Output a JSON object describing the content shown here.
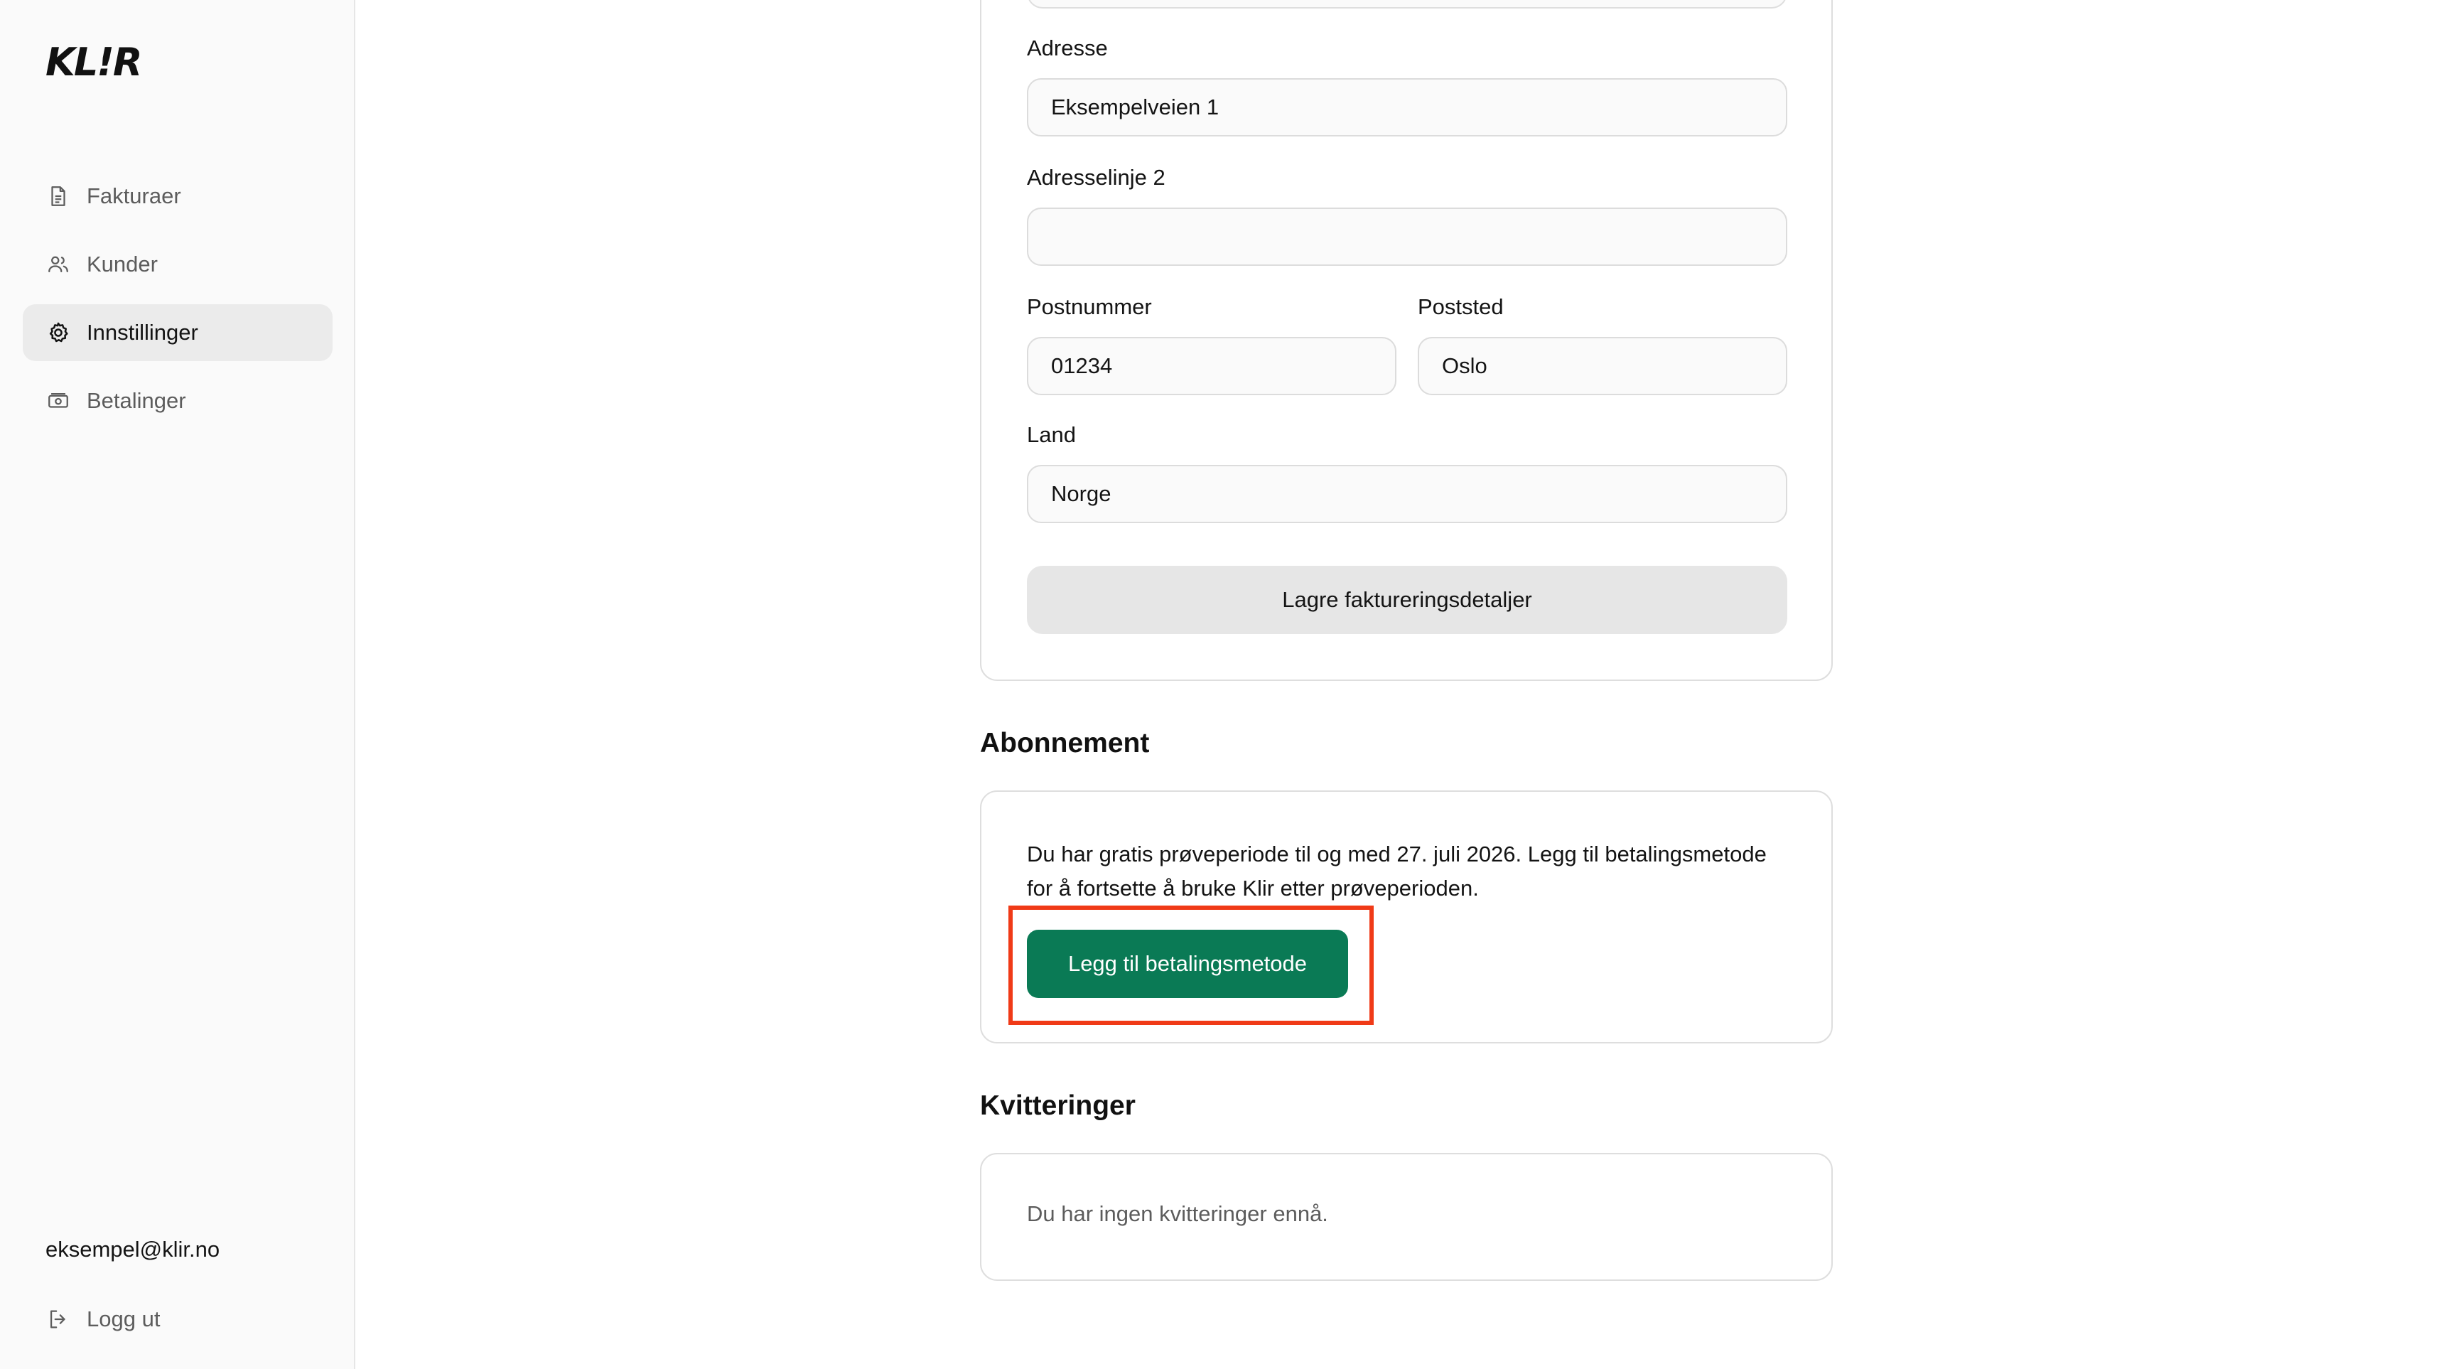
{
  "app": {
    "logo_text": "KL!R"
  },
  "sidebar": {
    "items": [
      {
        "label": "Fakturaer",
        "icon": "document-icon",
        "active": false
      },
      {
        "label": "Kunder",
        "icon": "users-icon",
        "active": false
      },
      {
        "label": "Innstillinger",
        "icon": "gear-icon",
        "active": true
      },
      {
        "label": "Betalinger",
        "icon": "banknote-icon",
        "active": false
      }
    ],
    "user_email": "eksempel@klir.no",
    "logout_label": "Logg ut",
    "logout_icon": "logout-icon"
  },
  "billing_form": {
    "address_label": "Adresse",
    "address_value": "Eksempelveien 1",
    "address2_label": "Adresselinje 2",
    "address2_value": "",
    "postal_code_label": "Postnummer",
    "postal_code_value": "01234",
    "city_label": "Poststed",
    "city_value": "Oslo",
    "country_label": "Land",
    "country_value": "Norge",
    "save_label": "Lagre faktureringsdetaljer"
  },
  "subscription": {
    "title": "Abonnement",
    "text": "Du har gratis prøveperiode til og med 27. juli 2026. Legg til betalingsmetode for å fortsette å bruke Klir etter prøveperioden.",
    "button_label": "Legg til betalingsmetode"
  },
  "receipts": {
    "title": "Kvitteringer",
    "empty_text": "Du har ingen kvitteringer ennå."
  },
  "colors": {
    "primary": "#0a7a55",
    "highlight": "#f03a17",
    "sidebar_bg": "#fafafa",
    "active_nav_bg": "#ebebeb"
  }
}
